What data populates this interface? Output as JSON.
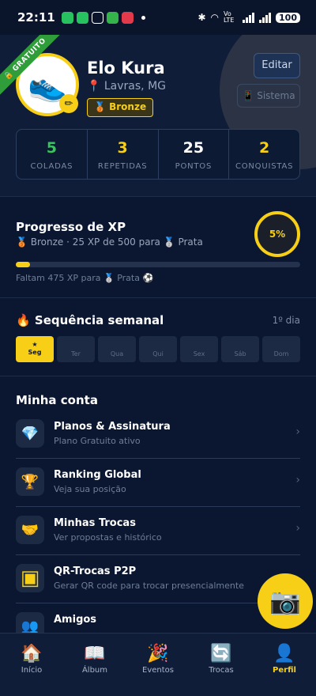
{
  "status_bar": {
    "time": "22:11",
    "battery": "100",
    "network": "Vo LTE"
  },
  "profile": {
    "ribbon": "🔒 GRATUITO",
    "avatar_icon": "sneaker",
    "name": "Elo Kura",
    "location": "📍 Lavras, MG",
    "level": "🥉 Bronze",
    "edit_label": "Editar",
    "system_label": "📱 Sistema"
  },
  "stats": [
    {
      "value": "5",
      "label": "COLADAS",
      "color": "#36c65b"
    },
    {
      "value": "3",
      "label": "REPETIDAS",
      "color": "#f7cf17"
    },
    {
      "value": "25",
      "label": "PONTOS",
      "color": "#ffffff"
    },
    {
      "value": "2",
      "label": "CONQUISTAS",
      "color": "#f7cf17"
    }
  ],
  "xp": {
    "title": "Progresso de XP",
    "subtitle": "🥉 Bronze · 25 XP de 500 para 🥈 Prata",
    "percent_label": "5%",
    "progress": 0.05,
    "remaining": "Faltam 475 XP para 🥈 Prata ⚽"
  },
  "streak": {
    "title": "🔥 Sequência semanal",
    "days_label": "1º dia",
    "week": [
      {
        "label": "Seg",
        "active": true,
        "mark": "★"
      },
      {
        "label": "Ter",
        "active": false
      },
      {
        "label": "Qua",
        "active": false
      },
      {
        "label": "Qui",
        "active": false
      },
      {
        "label": "Sex",
        "active": false
      },
      {
        "label": "Sáb",
        "active": false
      },
      {
        "label": "Dom",
        "active": false
      }
    ]
  },
  "account": {
    "title": "Minha conta",
    "items": [
      {
        "icon": "💎",
        "icon_name": "diamond-icon",
        "title": "Planos & Assinatura",
        "subtitle": "Plano Gratuito ativo"
      },
      {
        "icon": "🏆",
        "icon_name": "trophy-icon",
        "title": "Ranking Global",
        "subtitle": "Veja sua posição"
      },
      {
        "icon": "🤝",
        "icon_name": "handshake-icon",
        "title": "Minhas Trocas",
        "subtitle": "Ver propostas e histórico"
      },
      {
        "icon": "▣",
        "icon_name": "qr-code-icon",
        "title": "QR-Trocas P2P",
        "subtitle": "Gerar QR code para trocar presencialmente"
      },
      {
        "icon": "👥",
        "icon_name": "friends-icon",
        "title": "Amigos",
        "subtitle": ""
      }
    ]
  },
  "fab": {
    "icon": "📷"
  },
  "nav": [
    {
      "icon": "🏠",
      "label": "Início",
      "active": false
    },
    {
      "icon": "📖",
      "label": "Álbum",
      "active": false
    },
    {
      "icon": "🎉",
      "label": "Eventos",
      "active": false
    },
    {
      "icon": "🔄",
      "label": "Trocas",
      "active": false
    },
    {
      "icon": "👤",
      "label": "Perfil",
      "active": true
    }
  ],
  "colors": {
    "accent": "#f7cf17",
    "background": "#0b1730",
    "success": "#36c65b"
  }
}
